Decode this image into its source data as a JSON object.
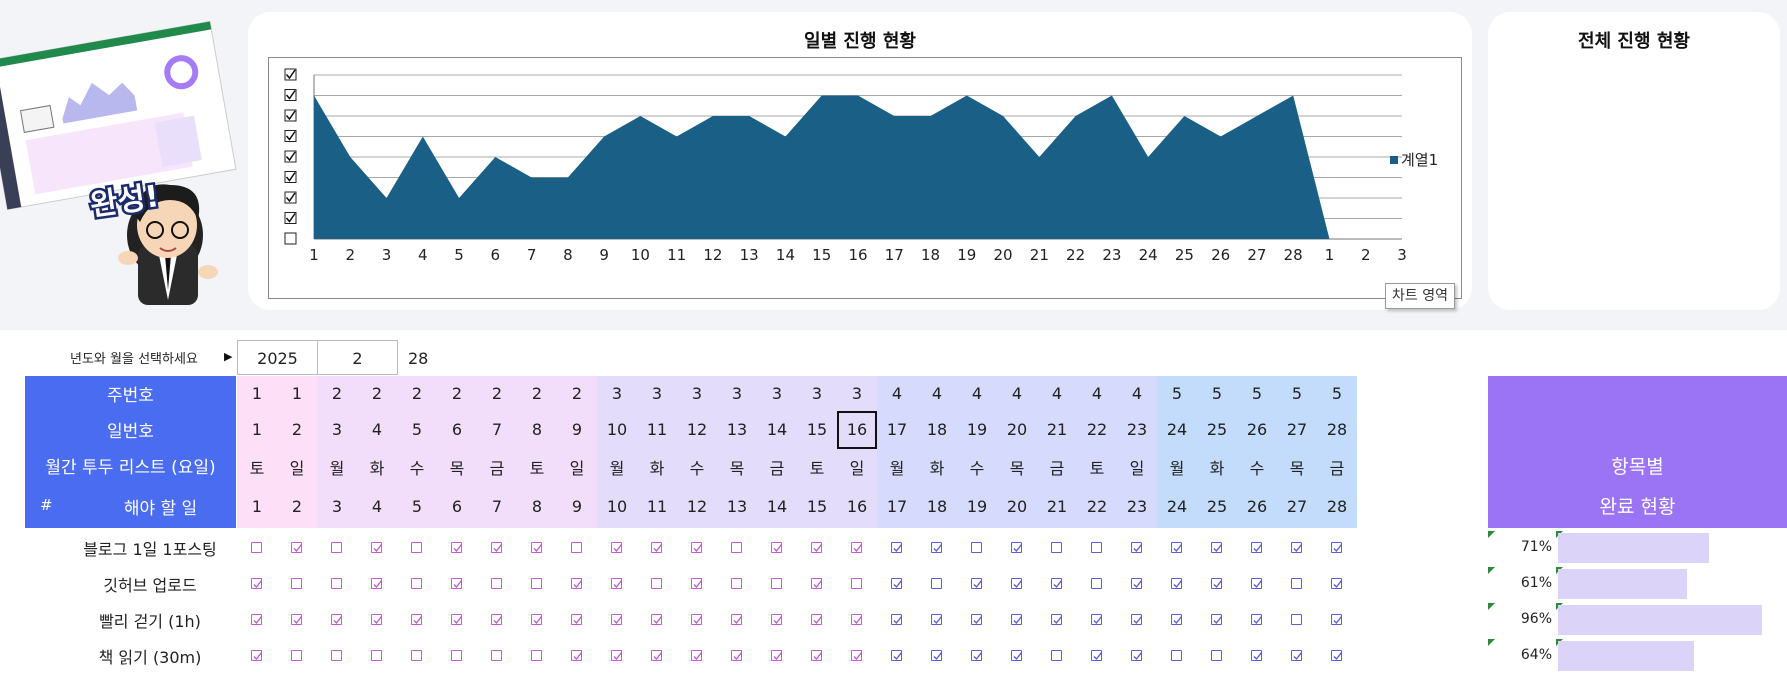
{
  "daily_chart": {
    "title": "일별 진행 현황",
    "legend": "계열1",
    "chart_area_tag": "차트 영역",
    "chart_data": {
      "type": "area",
      "x": [
        "1",
        "2",
        "3",
        "4",
        "5",
        "6",
        "7",
        "8",
        "9",
        "10",
        "11",
        "12",
        "13",
        "14",
        "15",
        "16",
        "17",
        "18",
        "19",
        "20",
        "21",
        "22",
        "23",
        "24",
        "25",
        "26",
        "27",
        "28",
        "1",
        "2",
        "3"
      ],
      "series": [
        {
          "name": "계열1",
          "values": [
            7,
            4,
            2,
            5,
            2,
            4,
            3,
            3,
            5,
            6,
            5,
            6,
            6,
            5,
            7,
            7,
            6,
            6,
            7,
            6,
            4,
            6,
            7,
            4,
            6,
            5,
            6,
            7,
            0,
            null,
            null
          ]
        }
      ],
      "ylim": [
        0,
        8
      ],
      "grid": true,
      "legend_position": "right",
      "color": "#1a5f85"
    }
  },
  "overall": {
    "title": "전체 진행 현황"
  },
  "selector": {
    "label": "년도와 월을 선택하세요",
    "year": "2025",
    "month": "2",
    "days": "28"
  },
  "header": {
    "week_label": "주번호",
    "day_label": "일번호",
    "list_label": "월간 투두 리스트 (요일)",
    "hash": "#",
    "todo_label": "해야 할 일",
    "weeks": [
      "1",
      "1",
      "2",
      "2",
      "2",
      "2",
      "2",
      "2",
      "2",
      "3",
      "3",
      "3",
      "3",
      "3",
      "3",
      "3",
      "4",
      "4",
      "4",
      "4",
      "4",
      "4",
      "4",
      "5",
      "5",
      "5",
      "5",
      "5"
    ],
    "days": [
      "1",
      "2",
      "3",
      "4",
      "5",
      "6",
      "7",
      "8",
      "9",
      "10",
      "11",
      "12",
      "13",
      "14",
      "15",
      "16",
      "17",
      "18",
      "19",
      "20",
      "21",
      "22",
      "23",
      "24",
      "25",
      "26",
      "27",
      "28"
    ],
    "weekdays": [
      "토",
      "일",
      "월",
      "화",
      "수",
      "목",
      "금",
      "토",
      "일",
      "월",
      "화",
      "수",
      "목",
      "금",
      "토",
      "일",
      "월",
      "화",
      "수",
      "목",
      "금",
      "토",
      "일",
      "월",
      "화",
      "수",
      "목",
      "금"
    ],
    "today_index": 15
  },
  "tasks": [
    {
      "name": "블로그 1일 1포스팅",
      "checks": [
        0,
        1,
        0,
        1,
        0,
        1,
        1,
        1,
        0,
        1,
        1,
        1,
        0,
        1,
        1,
        1,
        1,
        1,
        0,
        1,
        0,
        0,
        1,
        1,
        1,
        1,
        1,
        1
      ],
      "pct": "71%",
      "fraction": 0.71
    },
    {
      "name": "깃허브 업로드",
      "checks": [
        1,
        0,
        0,
        1,
        0,
        1,
        0,
        0,
        1,
        1,
        0,
        1,
        0,
        0,
        1,
        0,
        1,
        0,
        1,
        1,
        1,
        0,
        1,
        1,
        1,
        1,
        0,
        1
      ],
      "pct": "61%",
      "fraction": 0.61
    },
    {
      "name": "빨리 걷기 (1h)",
      "checks": [
        1,
        1,
        1,
        1,
        1,
        1,
        1,
        1,
        1,
        1,
        1,
        1,
        1,
        1,
        1,
        1,
        1,
        1,
        1,
        1,
        1,
        1,
        1,
        1,
        1,
        1,
        0,
        1
      ],
      "pct": "96%",
      "fraction": 0.96
    },
    {
      "name": "책 읽기 (30m)",
      "checks": [
        1,
        0,
        0,
        0,
        0,
        0,
        0,
        0,
        1,
        1,
        1,
        1,
        1,
        1,
        1,
        1,
        1,
        1,
        1,
        1,
        0,
        1,
        1,
        0,
        0,
        1,
        1,
        1
      ],
      "pct": "64%",
      "fraction": 0.64
    }
  ],
  "completion": {
    "line1": "항목별",
    "line2": "완료 현황"
  },
  "colors": {
    "header_blue": "#4a6cf0",
    "header_purple": "#9a74f4",
    "chart_fill": "#1a5f85"
  },
  "sticker": {
    "text": "완성!"
  }
}
